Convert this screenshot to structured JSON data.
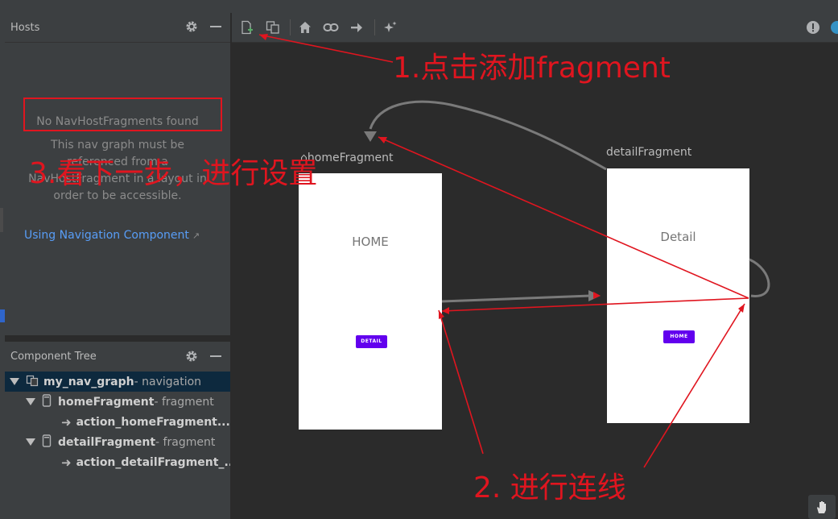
{
  "hosts": {
    "title": "Hosts",
    "empty_title": "No NavHostFragments found",
    "empty_desc": "This nav graph must be referenced from a NavHostFragment in a layout in order to be accessible.",
    "link": "Using Navigation Component",
    "link_arrow": "↗"
  },
  "tree": {
    "title": "Component Tree",
    "rows": [
      {
        "name": "my_nav_graph",
        "kind": " - navigation"
      },
      {
        "name": "homeFragment",
        "kind": " - fragment"
      },
      {
        "name": "action_homeFragment...",
        "kind": ""
      },
      {
        "name": "detailFragment",
        "kind": " - fragment"
      },
      {
        "name": "action_detailFragment_...",
        "kind": ""
      }
    ]
  },
  "canvas": {
    "home": {
      "label": "homeFragment",
      "screen_text": "HOME",
      "button": "DETAIL"
    },
    "detail": {
      "label": "detailFragment",
      "screen_text": "Detail",
      "button": "HOME"
    }
  },
  "annotations": {
    "step1": "1.点击添加fragment",
    "step2": "2. 进行连线",
    "step3": "3.看下一步，进行设置"
  },
  "colors": {
    "panel": "#3c3f41",
    "canvas": "#2b2b2b",
    "link": "#589df6",
    "annotation": "#e0151f",
    "button": "#6200ee",
    "selected_row": "#0d293e"
  }
}
